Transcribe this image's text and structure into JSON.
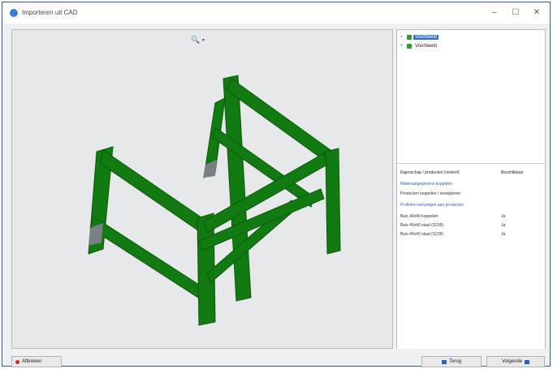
{
  "window": {
    "title": "Importeren uit CAD",
    "controls": {
      "minimize": "–",
      "maximize": "☐",
      "close": "✕"
    }
  },
  "viewport": {
    "tool_icons": [
      "zoom-icon",
      "camera-icon"
    ]
  },
  "tree": {
    "items": [
      {
        "expander": "+",
        "label": "Voorbeeld",
        "selected": true
      },
      {
        "expander": "+",
        "label": "Voorbeeld",
        "selected": false
      }
    ]
  },
  "properties": {
    "header_left": "Eigenschap / producten (verkort)",
    "header_right": "Beschikbaar",
    "rows": [
      {
        "text": "Materiaalgegevens koppelen",
        "value": "",
        "link": true
      },
      {
        "text": "Producten koppelen / verwijderen",
        "value": "",
        "link": false
      },
      {
        "text": "Profielen toevoegen aan producten",
        "value": "",
        "link": true
      },
      {
        "text": "Buis 40x40 koppelen",
        "value": "Ja",
        "link": false
      },
      {
        "text": "Buis 40x40 staal (S235)",
        "value": "Ja",
        "link": false
      },
      {
        "text": "Buis 40x40 staal (S235)",
        "value": "Ja",
        "link": false
      }
    ]
  },
  "footer": {
    "cancel_label": "Afbreken",
    "back_label": "Terug",
    "next_label": "Volgende"
  },
  "colors": {
    "frame_green": "#117a11",
    "accent_blue": "#2f6fd6"
  }
}
